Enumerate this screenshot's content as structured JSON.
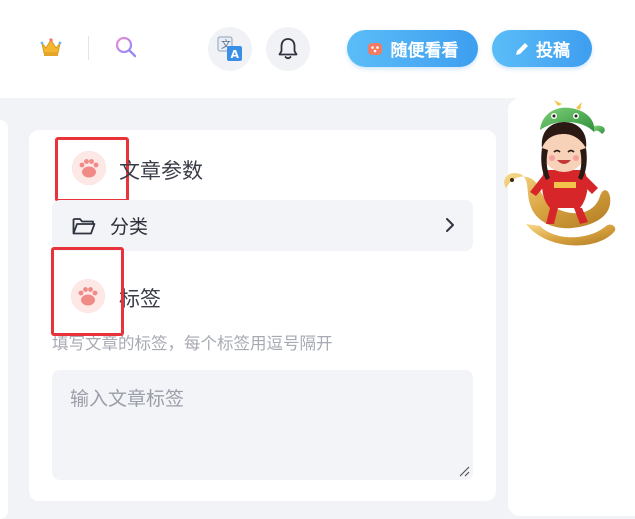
{
  "header": {
    "crown_icon": "crown-icon",
    "search_icon": "search-icon",
    "translate_icon": "translate-icon",
    "bell_icon": "bell-icon",
    "random_button": {
      "label": "随便看看",
      "icon": "dice-icon"
    },
    "submit_button": {
      "label": "投稿",
      "icon": "pencil-icon"
    },
    "accent_color": "#3e9ef0"
  },
  "form": {
    "section_params": {
      "title": "文章参数",
      "icon": "paw-icon"
    },
    "category": {
      "label": "分类",
      "icon": "folder-icon",
      "arrow_icon": "chevron-right-icon"
    },
    "section_tags": {
      "title": "标签",
      "icon": "paw-icon"
    },
    "tags_hint": "填写文章的标签，每个标签用逗号隔开",
    "tags_input": {
      "value": "",
      "placeholder": "输入文章标签"
    }
  },
  "decor": {
    "mascot": "dragon-girl-mascot"
  }
}
